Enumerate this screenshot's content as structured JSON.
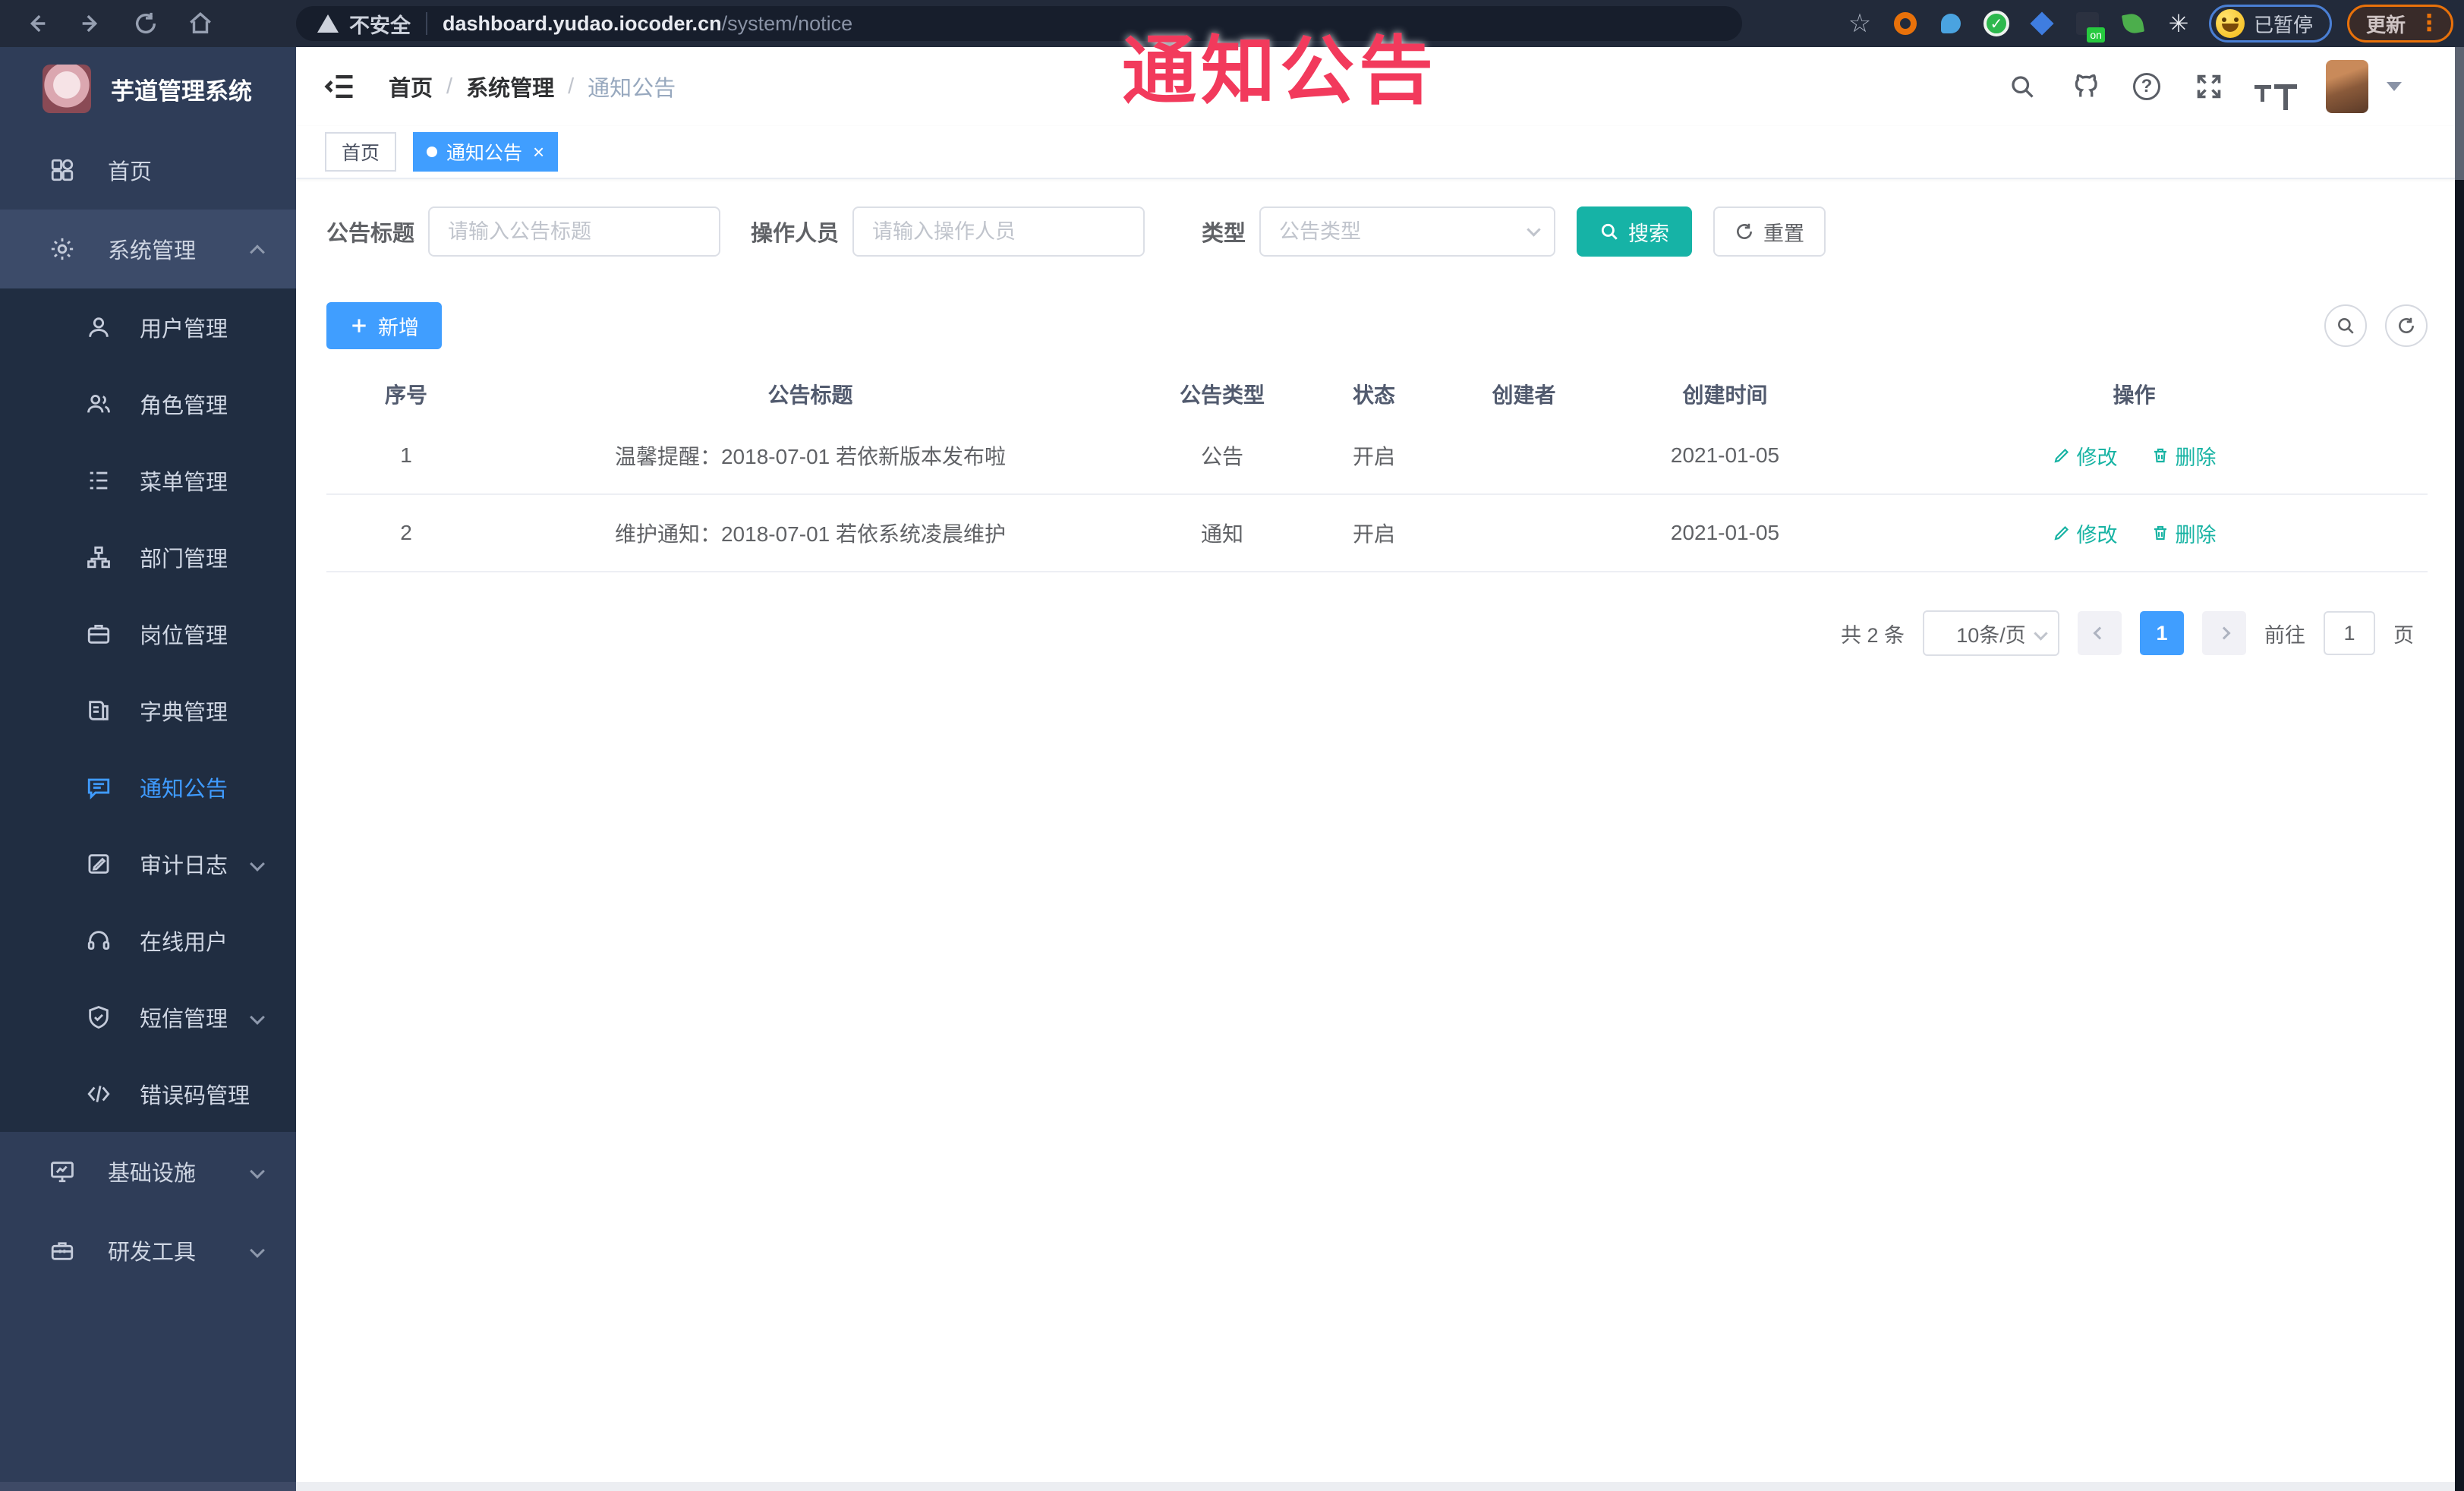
{
  "overlay": {
    "label": "通知公告"
  },
  "glyphs": {
    "close": "×",
    "help": "?",
    "star": "☆",
    "overflow": "⋮",
    "flower": "✳",
    "check": "✓"
  },
  "browser": {
    "insecure_label": "不安全",
    "url_host": "dashboard.yudao.iocoder.cn",
    "url_path": "/system/notice",
    "extension_on_badge": "on",
    "profile_label": "已暂停",
    "update_label": "更新"
  },
  "sidebar": {
    "title": "芋道管理系统",
    "items": [
      {
        "label": "首页"
      },
      {
        "label": "系统管理"
      },
      {
        "label": "用户管理"
      },
      {
        "label": "角色管理"
      },
      {
        "label": "菜单管理"
      },
      {
        "label": "部门管理"
      },
      {
        "label": "岗位管理"
      },
      {
        "label": "字典管理"
      },
      {
        "label": "通知公告"
      },
      {
        "label": "审计日志"
      },
      {
        "label": "在线用户"
      },
      {
        "label": "短信管理"
      },
      {
        "label": "错误码管理"
      },
      {
        "label": "基础设施"
      },
      {
        "label": "研发工具"
      }
    ]
  },
  "header": {
    "breadcrumb": {
      "home": "首页",
      "section": "系统管理",
      "current": "通知公告",
      "separator": "/"
    }
  },
  "tabs": {
    "home_label": "首页",
    "active_label": "通知公告"
  },
  "filters": {
    "title_label": "公告标题",
    "title_placeholder": "请输入公告标题",
    "operator_label": "操作人员",
    "operator_placeholder": "请输入操作人员",
    "type_label": "类型",
    "type_placeholder": "公告类型",
    "search_label": "搜索",
    "reset_label": "重置"
  },
  "toolbar": {
    "add_label": "新增"
  },
  "table": {
    "columns": {
      "no": "序号",
      "title": "公告标题",
      "type": "公告类型",
      "status": "状态",
      "creator": "创建者",
      "created": "创建时间",
      "actions": "操作"
    },
    "rows": [
      {
        "no": "1",
        "title": "温馨提醒：2018-07-01 若依新版本发布啦",
        "type": "公告",
        "status": "开启",
        "creator": "",
        "created": "2021-01-05"
      },
      {
        "no": "2",
        "title": "维护通知：2018-07-01 若依系统凌晨维护",
        "type": "通知",
        "status": "开启",
        "creator": "",
        "created": "2021-01-05"
      }
    ],
    "actions": {
      "edit": "修改",
      "delete": "删除"
    }
  },
  "pagination": {
    "total_text": "共 2 条",
    "page_size": "10条/页",
    "current": "1",
    "goto_label": "前往",
    "goto_value": "1",
    "page_label": "页"
  },
  "colors": {
    "accent_blue": "#409eff",
    "accent_teal": "#16b3a6",
    "annotation_red": "#f23a5c"
  }
}
